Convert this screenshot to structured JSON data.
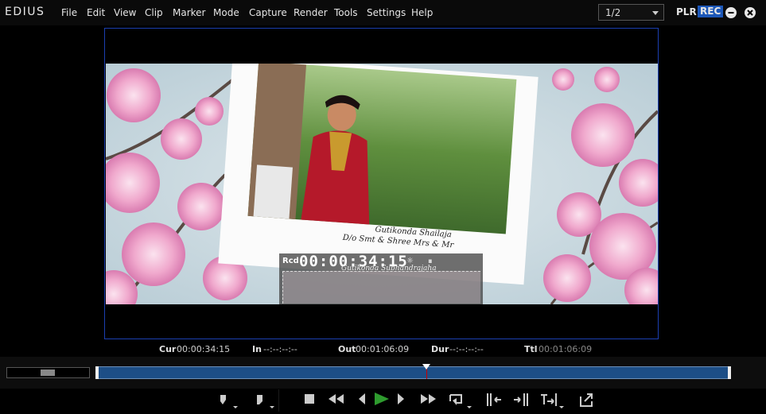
{
  "app": {
    "logo": "EDIUS"
  },
  "menu": [
    "File",
    "Edit",
    "View",
    "Clip",
    "Marker",
    "Mode",
    "Capture",
    "Render",
    "Tools",
    "Settings",
    "Help"
  ],
  "view_select": {
    "value": "1/2"
  },
  "record_mode": {
    "plr": "PLR",
    "rec": "REC"
  },
  "overlay": {
    "rcd_label": "Rcd",
    "timecode": "00:00:34:15"
  },
  "photo_caption": [
    "Gutikonda Shailaja",
    "D/o Smt & Shree Mrs & Mr",
    "Gutikonda Subhandrajaha"
  ],
  "timecodes": {
    "cur": {
      "label": "Cur",
      "value": "00:00:34:15"
    },
    "in": {
      "label": "In",
      "value": "--:--:--:--"
    },
    "out": {
      "label": "Out",
      "value": "00:01:06:09"
    },
    "dur": {
      "label": "Dur",
      "value": "--:--:--:--"
    },
    "ttl": {
      "label": "Ttl",
      "value": "00:01:06:09"
    }
  },
  "playback": {
    "position_fraction": 0.52
  },
  "colors": {
    "accent_blue": "#1c57b8",
    "monitor_border": "#1b3fb0",
    "timeline_fill": "#1d4e86",
    "play_green": "#2e9b2e"
  },
  "transport_icons": [
    "set-in-icon",
    "set-out-icon",
    "stop-icon",
    "rewind-icon",
    "step-back-icon",
    "play-icon",
    "step-forward-icon",
    "fast-forward-icon",
    "loop-icon",
    "jump-in-icon",
    "jump-out-icon",
    "jump-end-icon",
    "export-icon"
  ]
}
